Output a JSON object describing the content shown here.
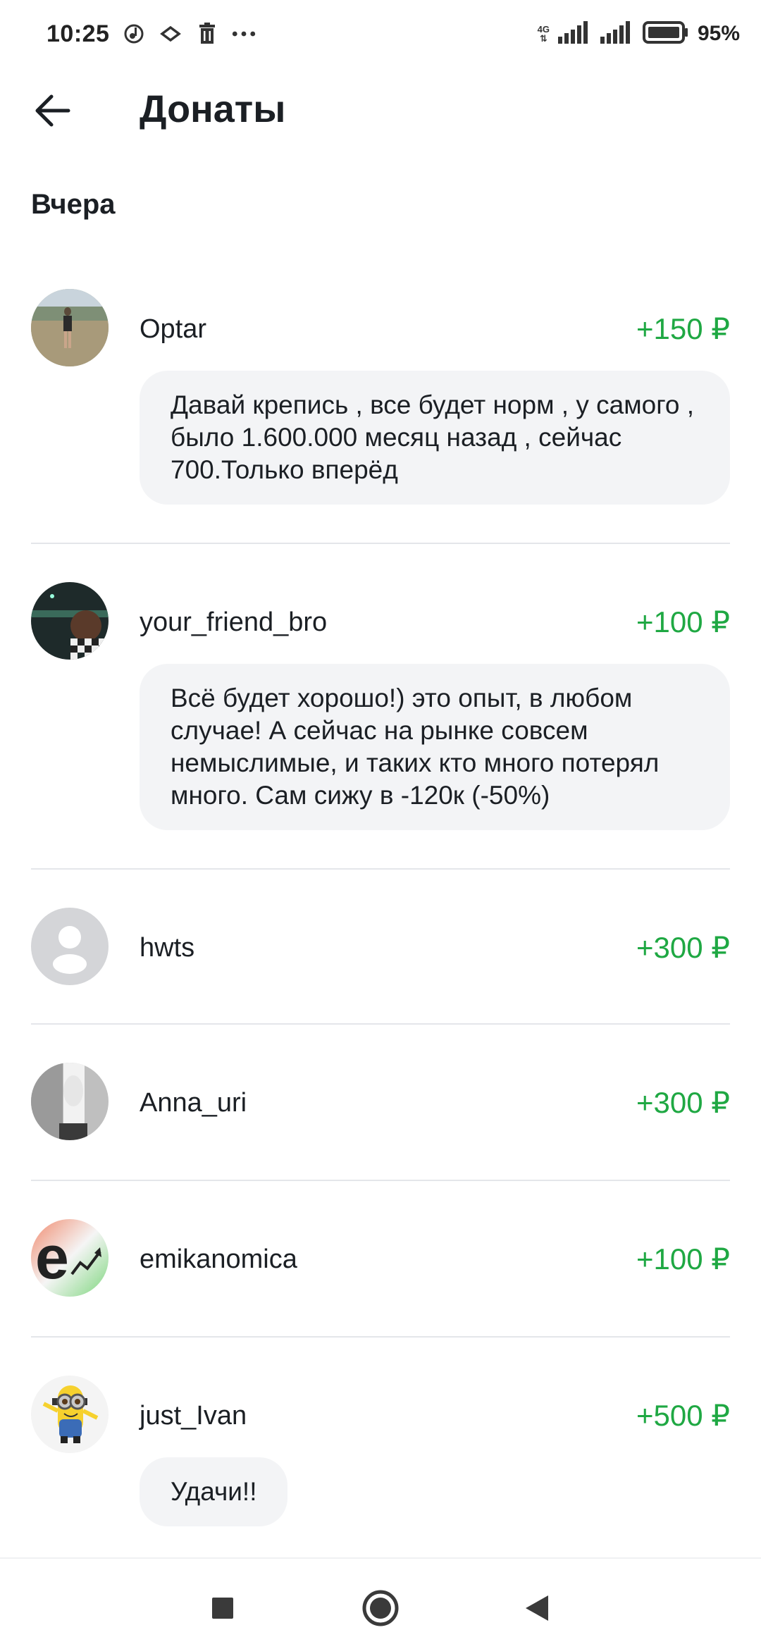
{
  "status_bar": {
    "time": "10:25",
    "network": "4G",
    "battery": "95%"
  },
  "header": {
    "title": "Донаты",
    "back_icon": "arrow-left-icon"
  },
  "section": {
    "title": "Вчера"
  },
  "donations": [
    {
      "name": "Optar",
      "amount": "+150 ₽",
      "message": "Давай крепись , все будет норм , у самого , было 1.600.000 месяц назад , сейчас 700.Только вперёд"
    },
    {
      "name": "your_friend_bro",
      "amount": "+100 ₽",
      "message": "Всё будет хорошо!) это опыт, в любом случае! А сейчас на рынке совсем немыслимые, и таких кто много потерял много. Сам сижу в -120к (-50%)"
    },
    {
      "name": "hwts",
      "amount": "+300 ₽"
    },
    {
      "name": "Anna_uri",
      "amount": "+300 ₽"
    },
    {
      "name": "emikanomica",
      "amount": "+100 ₽"
    },
    {
      "name": "just_Ivan",
      "amount": "+500 ₽",
      "message": "Удачи!!"
    }
  ],
  "colors": {
    "accent_green": "#1fa843",
    "bubble": "#f3f4f6",
    "divider": "#e4e6ea"
  },
  "nav": {
    "recents_icon": "square-icon",
    "home_icon": "circle-icon",
    "back_icon": "triangle-back-icon"
  }
}
